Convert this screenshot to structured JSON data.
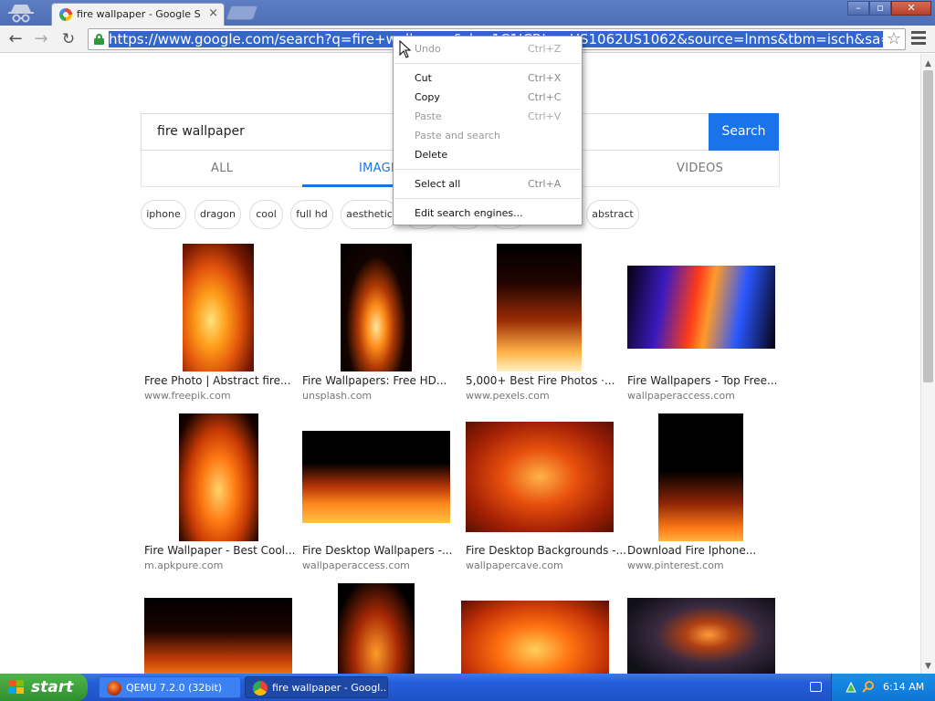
{
  "browser": {
    "tab_title": "fire wallpaper - Google Search",
    "tab_close": "×",
    "url": "https://www.google.com/search?q=fire+wallpaper&rlz=1C1JCRI_enUS1062US1062&source=lnms&tbm=isch&sa=X&ved=",
    "star_glyph": "☆"
  },
  "search": {
    "query": "fire wallpaper",
    "button_label": "Search",
    "tabs": {
      "all": "ALL",
      "images": "IMAGES",
      "videos": "VIDEOS"
    },
    "chips": [
      "iphone",
      "dragon",
      "cool",
      "full hd",
      "aesthetic",
      "abstract"
    ]
  },
  "results": [
    {
      "title": "Free Photo | Abstract fire...",
      "source": "www.freepik.com"
    },
    {
      "title": "Fire Wallpapers: Free HD...",
      "source": "unsplash.com"
    },
    {
      "title": "5,000+ Best Fire Photos ·...",
      "source": "www.pexels.com"
    },
    {
      "title": "Fire Wallpapers - Top Free...",
      "source": "wallpaperaccess.com"
    },
    {
      "title": "Fire Wallpaper - Best Cool...",
      "source": "m.apkpure.com"
    },
    {
      "title": "Fire Desktop Wallpapers -...",
      "source": "wallpaperaccess.com"
    },
    {
      "title": "Fire Desktop Backgrounds -...",
      "source": "wallpapercave.com"
    },
    {
      "title": "Download Fire Iphone...",
      "source": "www.pinterest.com"
    }
  ],
  "context_menu": {
    "items": [
      {
        "label": "Undo",
        "shortcut": "Ctrl+Z",
        "enabled": false
      },
      {
        "label": "Cut",
        "shortcut": "Ctrl+X",
        "enabled": true
      },
      {
        "label": "Copy",
        "shortcut": "Ctrl+C",
        "enabled": true
      },
      {
        "label": "Paste",
        "shortcut": "Ctrl+V",
        "enabled": false
      },
      {
        "label": "Paste and search",
        "shortcut": "",
        "enabled": false
      },
      {
        "label": "Delete",
        "shortcut": "",
        "enabled": true
      },
      {
        "label": "Select all",
        "shortcut": "Ctrl+A",
        "enabled": true
      },
      {
        "label": "Edit search engines...",
        "shortcut": "",
        "enabled": true
      }
    ]
  },
  "taskbar": {
    "start_label": "start",
    "tasks": [
      {
        "label": "QEMU 7.2.0 (32bit)"
      },
      {
        "label": "fire wallpaper - Googl..."
      }
    ],
    "clock": "6:14 AM"
  },
  "colors": {
    "accent": "#1a73e8",
    "url_selection": "#3366cc",
    "taskbar": "#245edb",
    "start_green": "#3c9a36"
  }
}
